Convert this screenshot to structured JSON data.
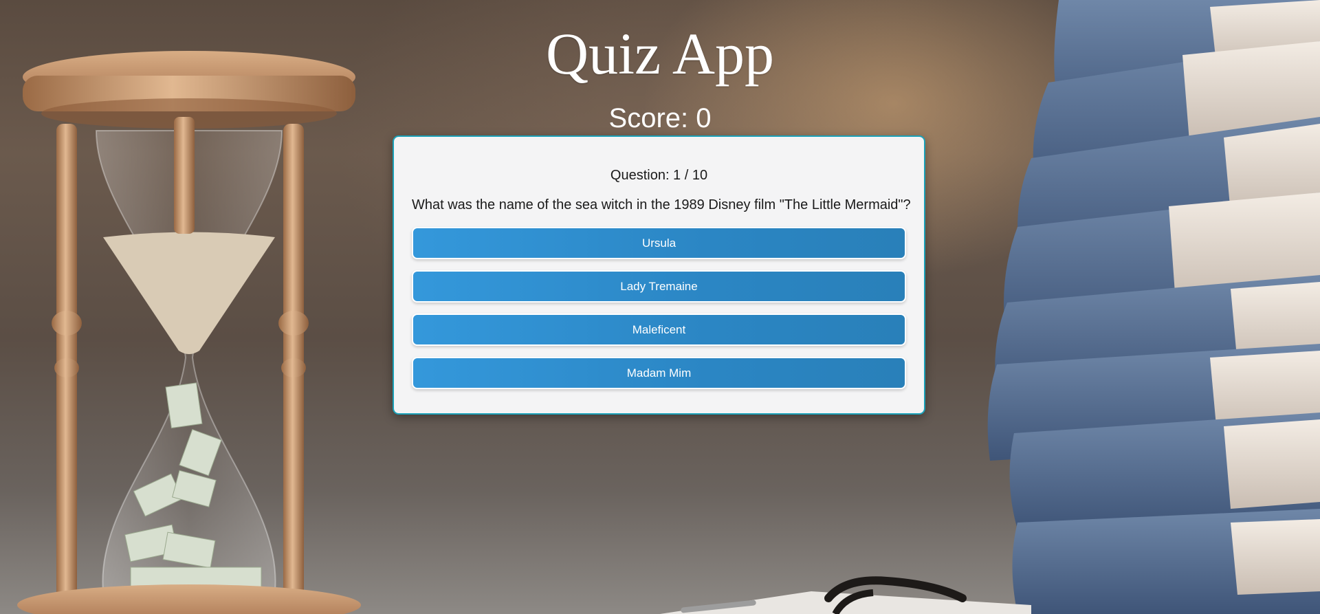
{
  "app": {
    "title": "Quiz App",
    "score_text": "Score: 0"
  },
  "quiz": {
    "question_counter": "Question: 1 / 10",
    "question_text": "What was the name of the sea witch in the 1989 Disney film \"The Little Mermaid\"?",
    "answers": [
      {
        "label": "Ursula"
      },
      {
        "label": "Lady Tremaine"
      },
      {
        "label": "Maleficent"
      },
      {
        "label": "Madam Mim"
      }
    ]
  },
  "colors": {
    "card_border": "#1aa1b8",
    "answer_button": "#3498db",
    "card_background": "#f4f4f5",
    "title_text": "#ffffff"
  },
  "icons": {
    "left_decoration": "hourglass-illustration",
    "right_decoration": "book-stack-illustration",
    "bottom_decoration": "eyeglasses-illustration"
  }
}
